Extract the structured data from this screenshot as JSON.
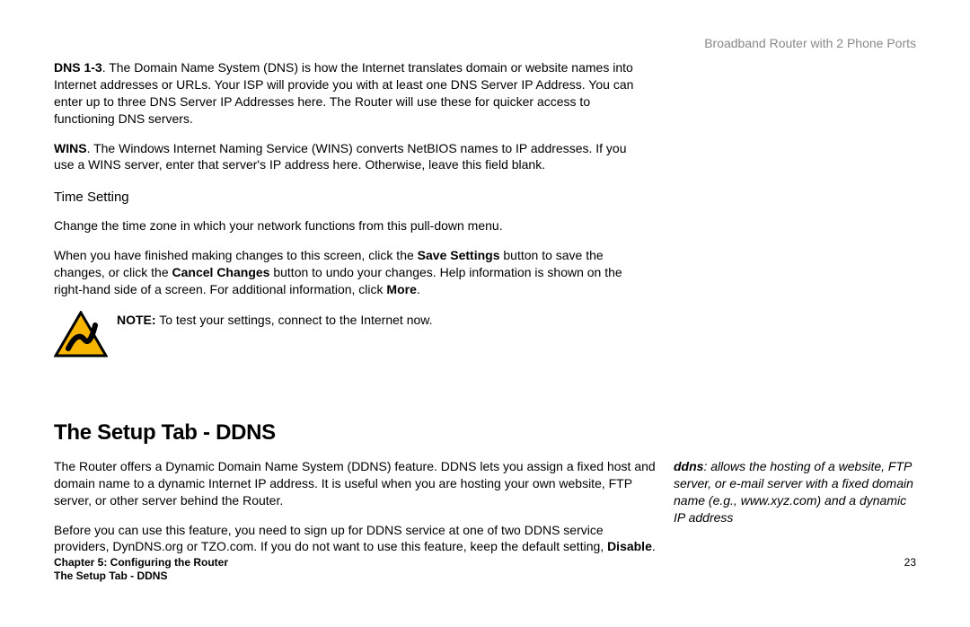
{
  "header": {
    "product": "Broadband Router with 2 Phone Ports"
  },
  "dns": {
    "label": "DNS 1-3",
    "text": ". The Domain Name System (DNS) is how the Internet translates domain or website names into Internet addresses or URLs. Your ISP will provide you with at least one DNS Server IP Address. You can enter up to three DNS Server IP Addresses here. The Router will use these for quicker access to functioning DNS servers."
  },
  "wins": {
    "label": "WINS",
    "text": ". The Windows Internet Naming Service (WINS) converts NetBIOS names to IP addresses. If you use a WINS server, enter that server's IP address here. Otherwise, leave this field blank."
  },
  "timesetting": {
    "heading": "Time Setting",
    "p1": "Change the time zone in which your network functions from this pull-down menu.",
    "p2_a": "When you have finished making changes to this screen, click the ",
    "p2_b1": "Save Settings",
    "p2_c": " button to save the changes, or click the ",
    "p2_b2": "Cancel Changes",
    "p2_d": " button to undo your changes. Help information is shown on the right-hand side of a screen. For additional information, click ",
    "p2_b3": "More",
    "p2_e": "."
  },
  "note": {
    "label": "NOTE:",
    "text": "  To test your settings, connect to the Internet now."
  },
  "ddns": {
    "title": "The Setup Tab - DDNS",
    "p1": "The Router offers a Dynamic Domain Name System (DDNS) feature. DDNS lets you assign a fixed host and domain name to a dynamic Internet IP address. It is useful when you are hosting your own website, FTP server, or other server behind the Router.",
    "p2_a": "Before you can use this feature, you need to sign up for DDNS service at one of two DDNS service providers, DynDNS.org or TZO.com. If you do not want to use this feature, keep the default setting, ",
    "p2_b": "Disable",
    "p2_c": ".",
    "gloss_term": "ddns",
    "gloss_text": ": allows the hosting of a website, FTP server, or e-mail server with a fixed domain name (e.g., www.xyz.com) and a dynamic IP address"
  },
  "footer": {
    "chapter": "Chapter 5: Configuring the Router",
    "section": "The Setup Tab - DDNS",
    "page": "23"
  }
}
